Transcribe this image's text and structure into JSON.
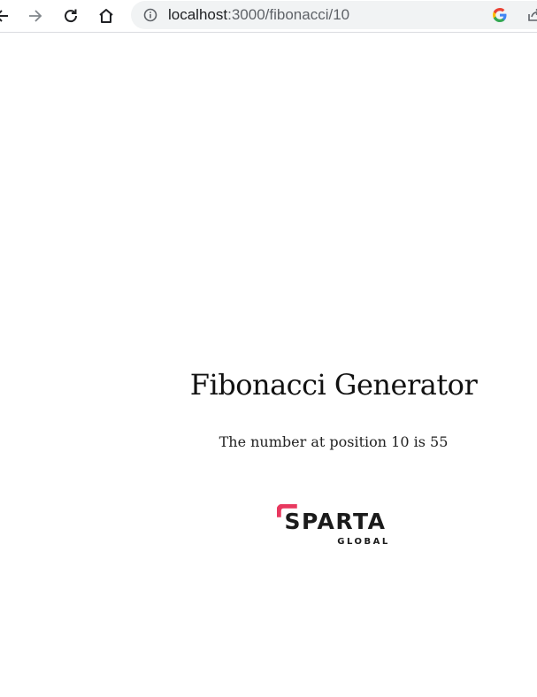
{
  "browser": {
    "url_host": "localhost",
    "url_path": ":3000/fibonacci/10",
    "icons": [
      "back-arrow-icon",
      "forward-arrow-icon",
      "reload-icon",
      "home-icon",
      "info-icon",
      "google-icon",
      "share-icon"
    ]
  },
  "page": {
    "title": "Fibonacci Generator",
    "result": "The number at position 10 is 55",
    "logo": {
      "main": "SPARTA",
      "sub": "GLOBAL",
      "accent": "#e8385f",
      "dark": "#1b1b1b"
    }
  }
}
